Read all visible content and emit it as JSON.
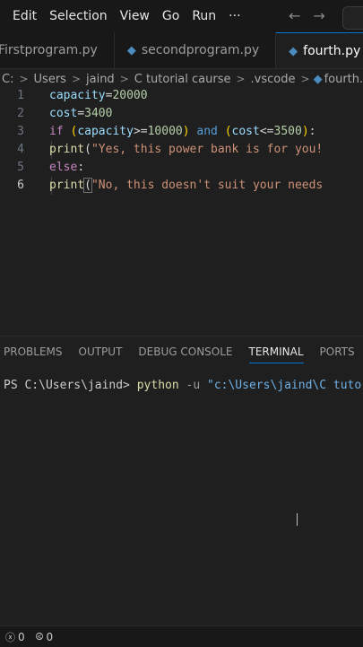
{
  "menubar": {
    "items": [
      "Edit",
      "Selection",
      "View",
      "Go",
      "Run",
      "···"
    ],
    "back_icon": "arrow-left-icon",
    "forward_icon": "arrow-right-icon"
  },
  "tabs": [
    {
      "label": "Firstprogram.py",
      "icon": "python-file-icon",
      "active": false
    },
    {
      "label": "secondprogram.py",
      "icon": "python-file-icon",
      "active": false
    },
    {
      "label": "fourth.py",
      "icon": "python-file-icon",
      "active": true
    }
  ],
  "breadcrumb": {
    "segments": [
      "C:",
      "Users",
      "jaind",
      "C tutorial caurse",
      ".vscode",
      "fourth.py"
    ],
    "separator": ">"
  },
  "editor": {
    "line_numbers": [
      "1",
      "2",
      "3",
      "4",
      "5",
      "6"
    ],
    "lines": [
      {
        "t": [
          [
            "v",
            "capacity"
          ],
          [
            "o",
            "="
          ],
          [
            "n",
            "20000"
          ]
        ]
      },
      {
        "t": [
          [
            "v",
            "cost"
          ],
          [
            "o",
            "="
          ],
          [
            "n",
            "3400"
          ]
        ]
      },
      {
        "t": [
          [
            "k",
            "if"
          ],
          [
            "o",
            " "
          ],
          [
            "p",
            "("
          ],
          [
            "v",
            "capacity"
          ],
          [
            "o",
            ">="
          ],
          [
            "n",
            "10000"
          ],
          [
            "p",
            ")"
          ],
          [
            "o",
            " "
          ],
          [
            "kb",
            "and"
          ],
          [
            "o",
            " "
          ],
          [
            "p",
            "("
          ],
          [
            "v",
            "cost"
          ],
          [
            "o",
            "<="
          ],
          [
            "n",
            "3500"
          ],
          [
            "p",
            ")"
          ],
          [
            "o",
            ":"
          ]
        ]
      },
      {
        "t": [
          [
            "o",
            "    "
          ],
          [
            "f",
            "print"
          ],
          [
            "o",
            "("
          ],
          [
            "s",
            "\"Yes, this power bank is for you!"
          ]
        ]
      },
      {
        "t": [
          [
            "k",
            "else"
          ],
          [
            "o",
            ":"
          ]
        ]
      },
      {
        "t": [
          [
            "o",
            "    "
          ],
          [
            "f",
            "print"
          ],
          [
            "o",
            "("
          ],
          [
            "s",
            "\"No, this doesn't suit your needs"
          ]
        ]
      }
    ]
  },
  "panel": {
    "tabs": [
      "PROBLEMS",
      "OUTPUT",
      "DEBUG CONSOLE",
      "TERMINAL",
      "PORTS"
    ],
    "active_tab": "TERMINAL",
    "terminal": {
      "prompt": "PS C:\\Users\\jaind> ",
      "command": "python",
      "flag": " -u ",
      "argument": "\"c:\\Users\\jaind\\C tutor"
    }
  },
  "statusbar": {
    "errors": "0",
    "ports": "0"
  },
  "colors": {
    "background": "#1f1f1f",
    "chrome": "#181818",
    "accent": "#0078d4"
  }
}
